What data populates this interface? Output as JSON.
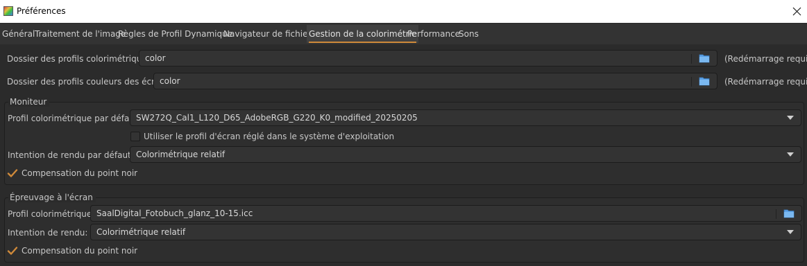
{
  "window": {
    "title": "Préférences"
  },
  "tabs": [
    {
      "label": "Général"
    },
    {
      "label": "Traitement de l'image"
    },
    {
      "label": "Règles de Profil Dynamique"
    },
    {
      "label": "Navigateur de fichiers"
    },
    {
      "label": "Gestion de la colorimétrie",
      "active": true
    },
    {
      "label": "Performance"
    },
    {
      "label": "Sons"
    }
  ],
  "folders": {
    "profiles_label": "Dossier des profils colorimétriques:",
    "profiles_value": "color",
    "profiles_note": "(Redémarrage requis)",
    "monitor_label": "Dossier des profils couleurs des écrans:",
    "monitor_value": "color",
    "monitor_note": "(Redémarrage requis)"
  },
  "monitor": {
    "legend": "Moniteur",
    "profile_label": "Profil colorimétrique par défaut:",
    "profile_value": "SW272Q_Cal1_L120_D65_AdobeRGB_G220_K0_modified_20250205",
    "use_os_profile_label": "Utiliser le profil d'écran réglé dans le système d'exploitation",
    "use_os_profile_checked": false,
    "intent_label": "Intention de rendu par défaut:",
    "intent_value": "Colorimétrique relatif",
    "bpc_label": "Compensation du point noir",
    "bpc_checked": true
  },
  "softproof": {
    "legend": "Épreuvage à l'écran",
    "profile_label": "Profil colorimétrique:",
    "profile_value": "SaalDigital_Fotobuch_glanz_10-15.icc",
    "intent_label": "Intention de rendu:",
    "intent_value": "Colorimétrique relatif",
    "bpc_label": "Compensation du point noir",
    "bpc_checked": true
  },
  "colors": {
    "accent": "#d08a3a",
    "folder_icon": "#5aa0e6",
    "background": "#2b2b2b"
  },
  "icons": {
    "app": "app-icon",
    "close": "close-icon",
    "folder": "folder-icon",
    "dropdown": "chevron-down-icon",
    "check": "checkmark-icon"
  }
}
